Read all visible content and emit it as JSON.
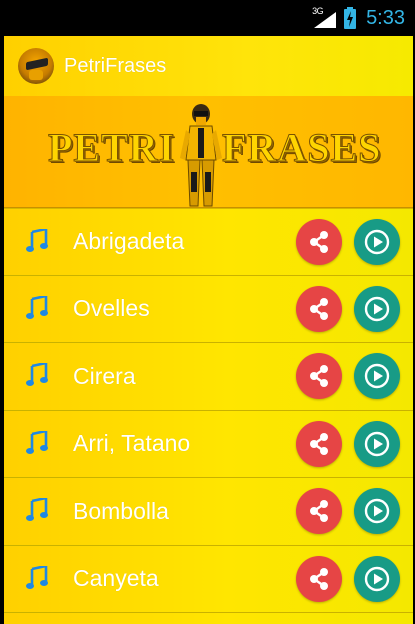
{
  "status_bar": {
    "network": "3G",
    "time": "5:33"
  },
  "app": {
    "title": "PetriFrases",
    "banner_text_left": "PETRI",
    "banner_text_right": "FRASES"
  },
  "sounds": [
    {
      "label": "Abrigadeta"
    },
    {
      "label": "Ovelles"
    },
    {
      "label": "Cirera"
    },
    {
      "label": "Arri, Tatano"
    },
    {
      "label": "Bombolla"
    },
    {
      "label": "Canyeta"
    }
  ],
  "icons": {
    "app": "petri-avatar-icon",
    "list_item": "music-note-icon",
    "share": "share-icon",
    "play": "play-circle-icon"
  },
  "colors": {
    "status_accent": "#33b5e5",
    "background_yellow": "#ffe600",
    "share_red": "#e64545",
    "play_teal": "#189b86"
  }
}
